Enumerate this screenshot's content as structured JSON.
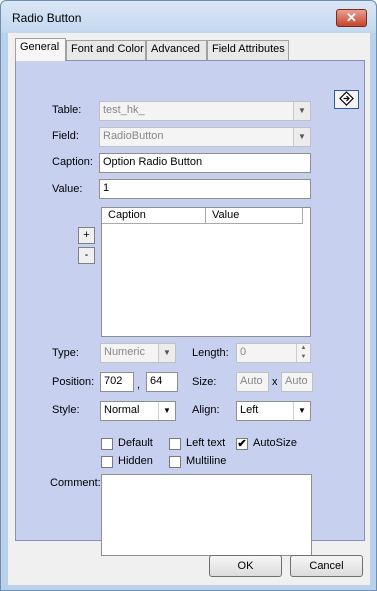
{
  "window": {
    "title": "Radio Button",
    "close_glyph": "✕"
  },
  "tabs": [
    {
      "label": "General",
      "active": true
    },
    {
      "label": "Font and Color",
      "active": false
    },
    {
      "label": "Advanced",
      "active": false
    },
    {
      "label": "Field Attributes",
      "active": false
    }
  ],
  "form": {
    "table_label": "Table:",
    "table_value": "test_hk_",
    "field_label": "Field:",
    "field_value": "RadioButton",
    "caption_label": "Caption:",
    "caption_value": "Option Radio Button",
    "value_label": "Value:",
    "value_value": "1",
    "list_col_caption": "Caption",
    "list_col_value": "Value",
    "add_glyph": "+",
    "remove_glyph": "-",
    "type_label": "Type:",
    "type_value": "Numeric",
    "length_label": "Length:",
    "length_value": "0",
    "position_label": "Position:",
    "position_x": "702",
    "position_sep": ",",
    "position_y": "64",
    "size_label": "Size:",
    "size_w": "Auto",
    "size_sep": "x",
    "size_h": "Auto",
    "style_label": "Style:",
    "style_value": "Normal",
    "align_label": "Align:",
    "align_value": "Left",
    "checkboxes": {
      "default": {
        "label": "Default",
        "checked": false
      },
      "left_text": {
        "label": "Left text",
        "checked": false
      },
      "autosize": {
        "label": "AutoSize",
        "checked": true
      },
      "hidden": {
        "label": "Hidden",
        "checked": false
      },
      "multiline": {
        "label": "Multiline",
        "checked": false
      }
    },
    "comment_label": "Comment:"
  },
  "check_glyph": "✔",
  "buttons": {
    "ok": "OK",
    "cancel": "Cancel"
  },
  "icons": {
    "corner_button": "diamond-arrow-icon"
  }
}
